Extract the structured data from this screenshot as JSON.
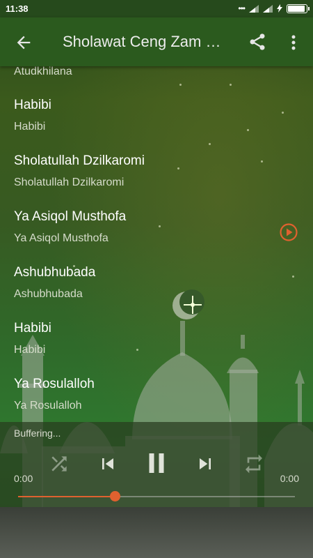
{
  "status_bar": {
    "time": "11:38",
    "icons": [
      "dots-icon",
      "signal-icon",
      "signal-icon",
      "charging-icon",
      "battery-icon"
    ]
  },
  "app_bar": {
    "back_icon": "arrow-left-icon",
    "title": "Sholawat Ceng Zam Zam",
    "share_icon": "share-icon",
    "more_icon": "more-vertical-icon",
    "color": "#2b5a1e"
  },
  "playlist": {
    "partial_top_subtitle": "Atudkhilana",
    "items": [
      {
        "title": "Habibi",
        "subtitle": "Habibi",
        "playing": false
      },
      {
        "title": "Sholatullah Dzilkaromi",
        "subtitle": "Sholatullah Dzilkaromi",
        "playing": false
      },
      {
        "title": "Ya Asiqol Musthofa",
        "subtitle": "Ya Asiqol Musthofa",
        "playing": true
      },
      {
        "title": "Ashubhubada",
        "subtitle": "Ashubhubada",
        "playing": false
      },
      {
        "title": "Habibi",
        "subtitle": "Habibi",
        "playing": false
      },
      {
        "title": "Ya Rosulalloh",
        "subtitle": "Ya Rosulalloh",
        "playing": false
      }
    ],
    "play_indicator_color": "#e0612f"
  },
  "player": {
    "status": "Buffering...",
    "elapsed": "0:00",
    "duration": "0:00",
    "progress_fraction": 0.35,
    "accent": "#e0612f",
    "controls": [
      "shuffle-icon",
      "skip-previous-icon",
      "pause-icon",
      "skip-next-icon",
      "repeat-icon"
    ]
  }
}
